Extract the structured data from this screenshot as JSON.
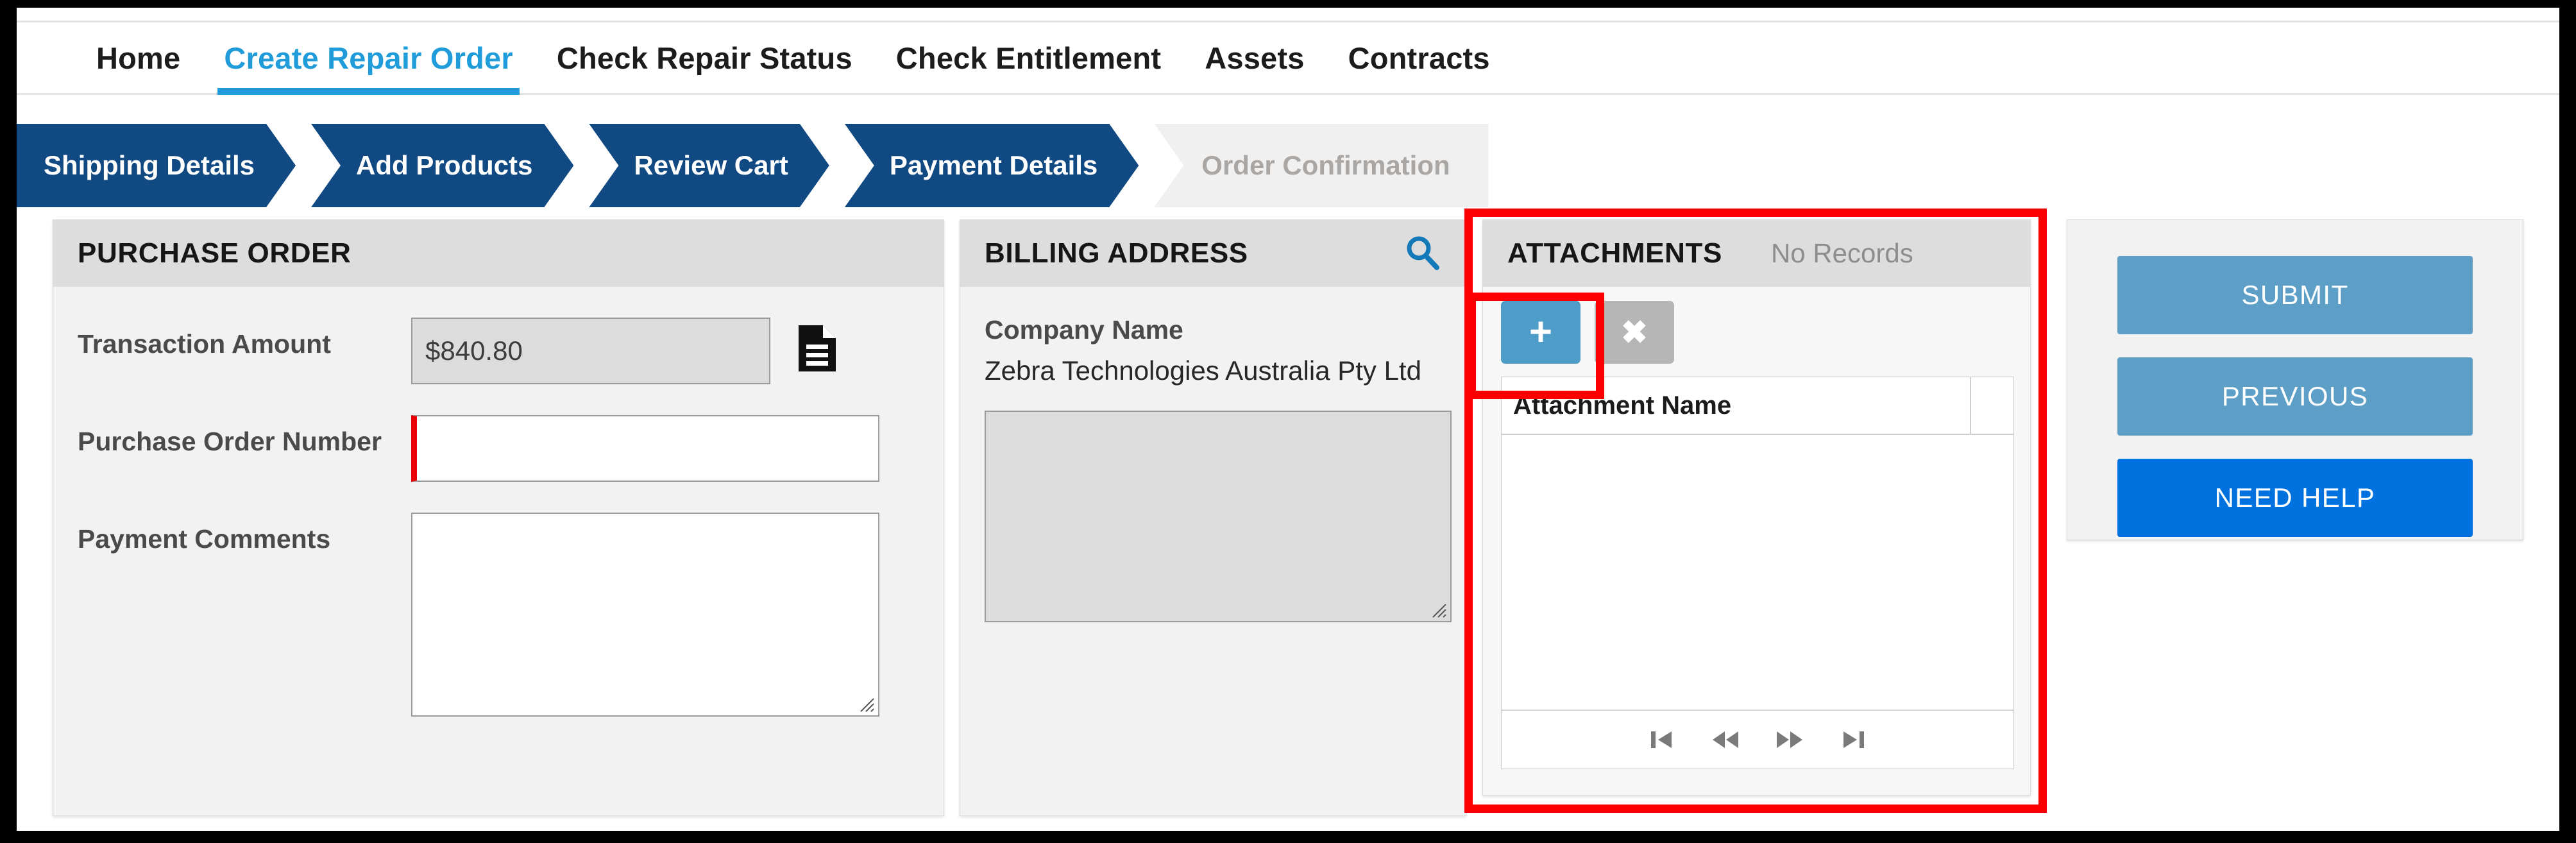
{
  "nav": {
    "tabs": [
      {
        "label": "Home",
        "active": false
      },
      {
        "label": "Create Repair Order",
        "active": true
      },
      {
        "label": "Check Repair Status",
        "active": false
      },
      {
        "label": "Check Entitlement",
        "active": false
      },
      {
        "label": "Assets",
        "active": false
      },
      {
        "label": "Contracts",
        "active": false
      }
    ]
  },
  "stepper": {
    "steps": [
      {
        "label": "Shipping Details",
        "state": "complete"
      },
      {
        "label": "Add Products",
        "state": "complete"
      },
      {
        "label": "Review Cart",
        "state": "complete"
      },
      {
        "label": "Payment Details",
        "state": "current"
      },
      {
        "label": "Order Confirmation",
        "state": "inactive"
      }
    ]
  },
  "purchase_order": {
    "title": "PURCHASE ORDER",
    "transaction_amount": {
      "label": "Transaction Amount",
      "value": "$840.80",
      "readonly": true
    },
    "purchase_order_number": {
      "label": "Purchase Order Number",
      "value": "",
      "placeholder": "",
      "required": true
    },
    "payment_comments": {
      "label": "Payment Comments",
      "value": "",
      "placeholder": ""
    },
    "document_icon": "document-icon"
  },
  "billing_address": {
    "title": "BILLING ADDRESS",
    "search_icon": "search-icon",
    "company_name_label": "Company Name",
    "company_name_value": "Zebra Technologies Australia Pty Ltd",
    "address_value": "",
    "address_readonly": true
  },
  "attachments": {
    "title": "ATTACHMENTS",
    "status": "No Records",
    "add_button_glyph": "+",
    "delete_button_glyph": "✖",
    "add_button_name": "plus-icon",
    "delete_button_name": "close-icon",
    "columns": [
      "Attachment Name"
    ],
    "rows": [],
    "pager": [
      {
        "name": "first-page-icon",
        "glyph": "⧏|"
      },
      {
        "name": "previous-page-icon",
        "glyph": "«"
      },
      {
        "name": "next-page-icon",
        "glyph": "»"
      },
      {
        "name": "last-page-icon",
        "glyph": "|⧐"
      }
    ]
  },
  "actions": {
    "submit_label": "SUBMIT",
    "previous_label": "PREVIOUS",
    "need_help_label": "NEED HELP"
  },
  "colors": {
    "accent_blue": "#1f9cd9",
    "step_blue": "#114a83",
    "button_muted": "#5d9fc6",
    "button_primary": "#0072e0",
    "annotation_red": "#fb0000",
    "required_red": "#e80000"
  }
}
